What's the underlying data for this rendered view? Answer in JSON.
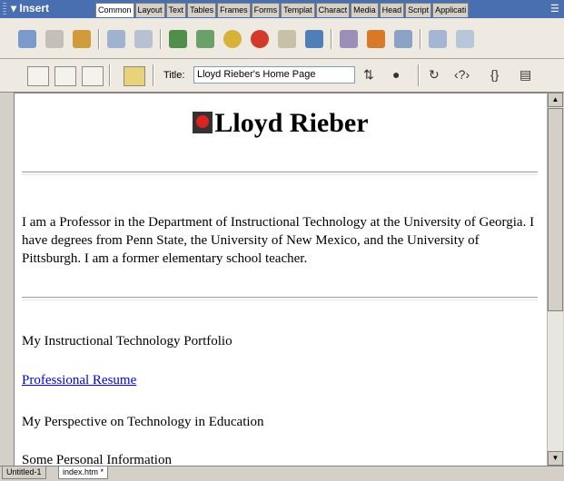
{
  "insert_bar": {
    "title": "▾ Insert",
    "tabs": [
      "Common",
      "Layout",
      "Text",
      "Tables",
      "Frames",
      "Forms",
      "Templat",
      "Charact",
      "Media",
      "Head",
      "Script",
      "Applicati"
    ],
    "active_tab": "Common"
  },
  "doc_toolbar": {
    "title_label": "Title:",
    "title_value": "Lloyd Rieber's Home Page"
  },
  "document": {
    "heading": "Lloyd Rieber",
    "paragraph": "I am a Professor in the Department of Instructional Technology at the University of Georgia. I have degrees from Penn State, the University of New Mexico, and the University of Pittsburgh. I am a former elementary school teacher.",
    "line_portfolio": "My Instructional Technology Portfolio",
    "link_resume": "Professional Resume",
    "line_perspective": "My Perspective on Technology in Education",
    "line_personal": "Some Personal Information"
  },
  "doc_tabs": [
    "Untitled-1",
    "index.htm *"
  ]
}
